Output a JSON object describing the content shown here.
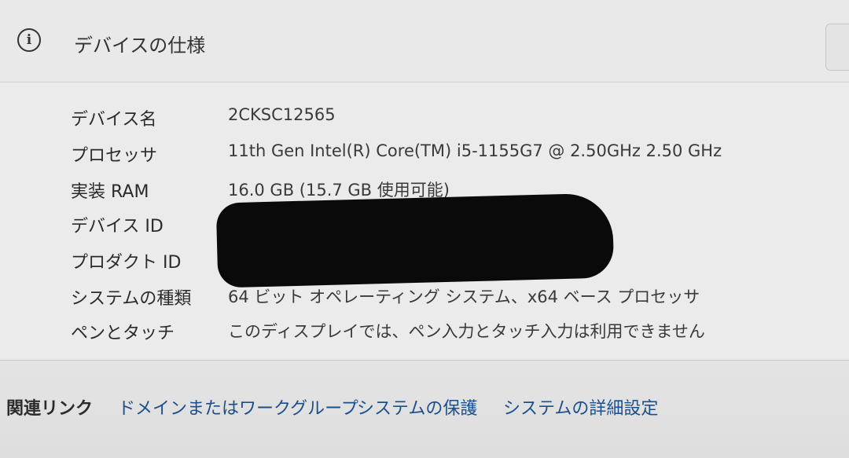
{
  "header": {
    "title": "デバイスの仕様",
    "icon": "info-icon"
  },
  "specs": [
    {
      "label": "デバイス名",
      "value": "2CKSC12565"
    },
    {
      "label": "プロセッサ",
      "value": "11th Gen Intel(R) Core(TM) i5-1155G7 @ 2.50GHz   2.50 GHz"
    },
    {
      "label": "実装 RAM",
      "value": "16.0 GB (15.7 GB 使用可能)"
    },
    {
      "label": "デバイス ID",
      "value": ""
    },
    {
      "label": "プロダクト ID",
      "value": ""
    },
    {
      "label": "システムの種類",
      "value": "64 ビット オペレーティング システム、x64 ベース プロセッサ"
    },
    {
      "label": "ペンとタッチ",
      "value": "このディスプレイでは、ペン入力とタッチ入力は利用できません"
    }
  ],
  "related": {
    "title": "関連リンク",
    "links": [
      {
        "label": "ドメインまたはワークグループ"
      },
      {
        "label": "システムの保護"
      },
      {
        "label": "システムの詳細設定"
      }
    ]
  },
  "colors": {
    "link": "#1b4f8c",
    "redaction": "#0a0a0a"
  }
}
